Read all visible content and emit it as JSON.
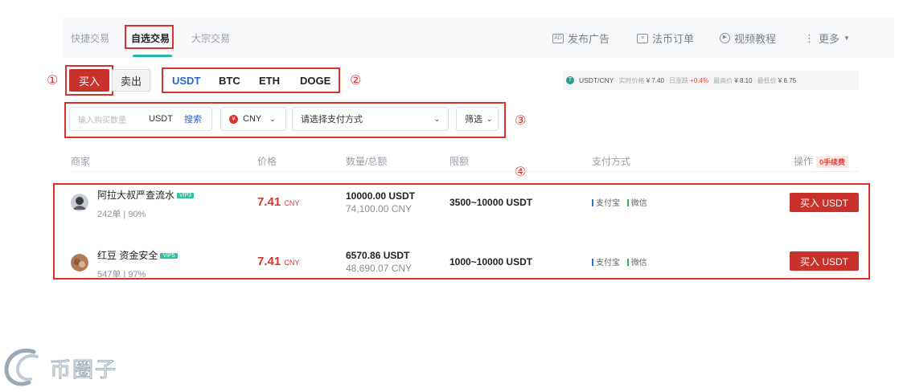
{
  "tabs": [
    "快捷交易",
    "自选交易",
    "大宗交易"
  ],
  "topnav": {
    "post_ad": "发布广告",
    "fiat_orders": "法币订单",
    "video_tutorial": "视频教程",
    "more": "更多"
  },
  "side": {
    "buy": "买入",
    "sell": "卖出"
  },
  "coins": [
    "USDT",
    "BTC",
    "ETH",
    "DOGE"
  ],
  "ticker": {
    "pair": "USDT/CNY",
    "realtime_label": "实时价格",
    "realtime_value": "¥ 7.40",
    "change_label": "日涨跌",
    "change_value": "+0.4%",
    "high_label": "最高价",
    "high_value": "¥ 8.10",
    "low_label": "最低价",
    "low_value": "¥ 6.75"
  },
  "filters": {
    "amount_placeholder": "输入购买数量",
    "amount_unit": "USDT",
    "search": "搜索",
    "currency": "CNY",
    "payment_placeholder": "请选择支付方式",
    "filter": "筛选"
  },
  "annotations": [
    "①",
    "②",
    "③",
    "④"
  ],
  "table": {
    "headers": {
      "merchant": "商家",
      "price": "价格",
      "qty_total": "数量/总额",
      "limit": "限额",
      "payment": "支付方式",
      "action": "操作"
    },
    "fee_badge": "0手续费",
    "rows": [
      {
        "name": "阿拉大叔严查流水",
        "vip": "VIP3",
        "stats": "242单 | 90%",
        "price": "7.41",
        "price_unit": "CNY",
        "qty": "10000.00 USDT",
        "total": "74,100.00 CNY",
        "limit": "3500~10000 USDT",
        "pay1": "支付宝",
        "pay2": "微信",
        "action": "买入 USDT"
      },
      {
        "name": "红豆 资金安全",
        "vip": "VIP5",
        "stats": "547单 | 97%",
        "price": "7.41",
        "price_unit": "CNY",
        "qty": "6570.86 USDT",
        "total": "48,690.07 CNY",
        "limit": "1000~10000 USDT",
        "pay1": "支付宝",
        "pay2": "微信",
        "action": "买入 USDT"
      }
    ]
  },
  "colors": {
    "brand_red": "#c9322c",
    "alipay": "#2a78d4",
    "wechat": "#2fb45a",
    "accent_teal": "#2bb5a0"
  },
  "watermark": "币圈子"
}
